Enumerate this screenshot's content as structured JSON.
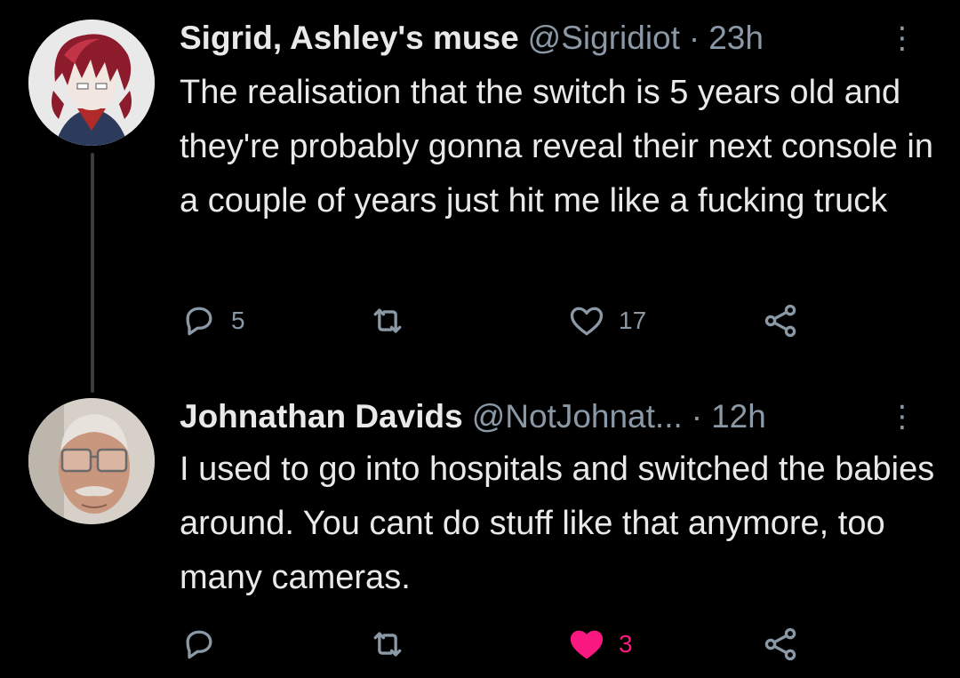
{
  "colors": {
    "background": "#000000",
    "text": "#e7e9ea",
    "secondary": "#8b98a5",
    "like_active": "#f91880"
  },
  "tweets": [
    {
      "display_name": "Sigrid, Ashley's muse",
      "handle": "@Sigridiot",
      "separator": "·",
      "time": "23h",
      "more": "⋮",
      "text": "The realisation that the switch is 5 years old and they're probably gonna reveal their next console in a couple of years just hit me like a fucking truck",
      "reply_count": "5",
      "retweet_count": "",
      "like_count": "17",
      "liked": false,
      "avatar_icon": "anime-character-avatar"
    },
    {
      "display_name": "Johnathan Davids",
      "handle": "@NotJohnat...",
      "separator": "·",
      "time": "12h",
      "more": "⋮",
      "text": "I used to go into hospitals and switched the babies around. You cant do stuff like that anymore, too many cameras.",
      "reply_count": "",
      "retweet_count": "",
      "like_count": "3",
      "liked": true,
      "avatar_icon": "old-man-avatar"
    }
  ]
}
